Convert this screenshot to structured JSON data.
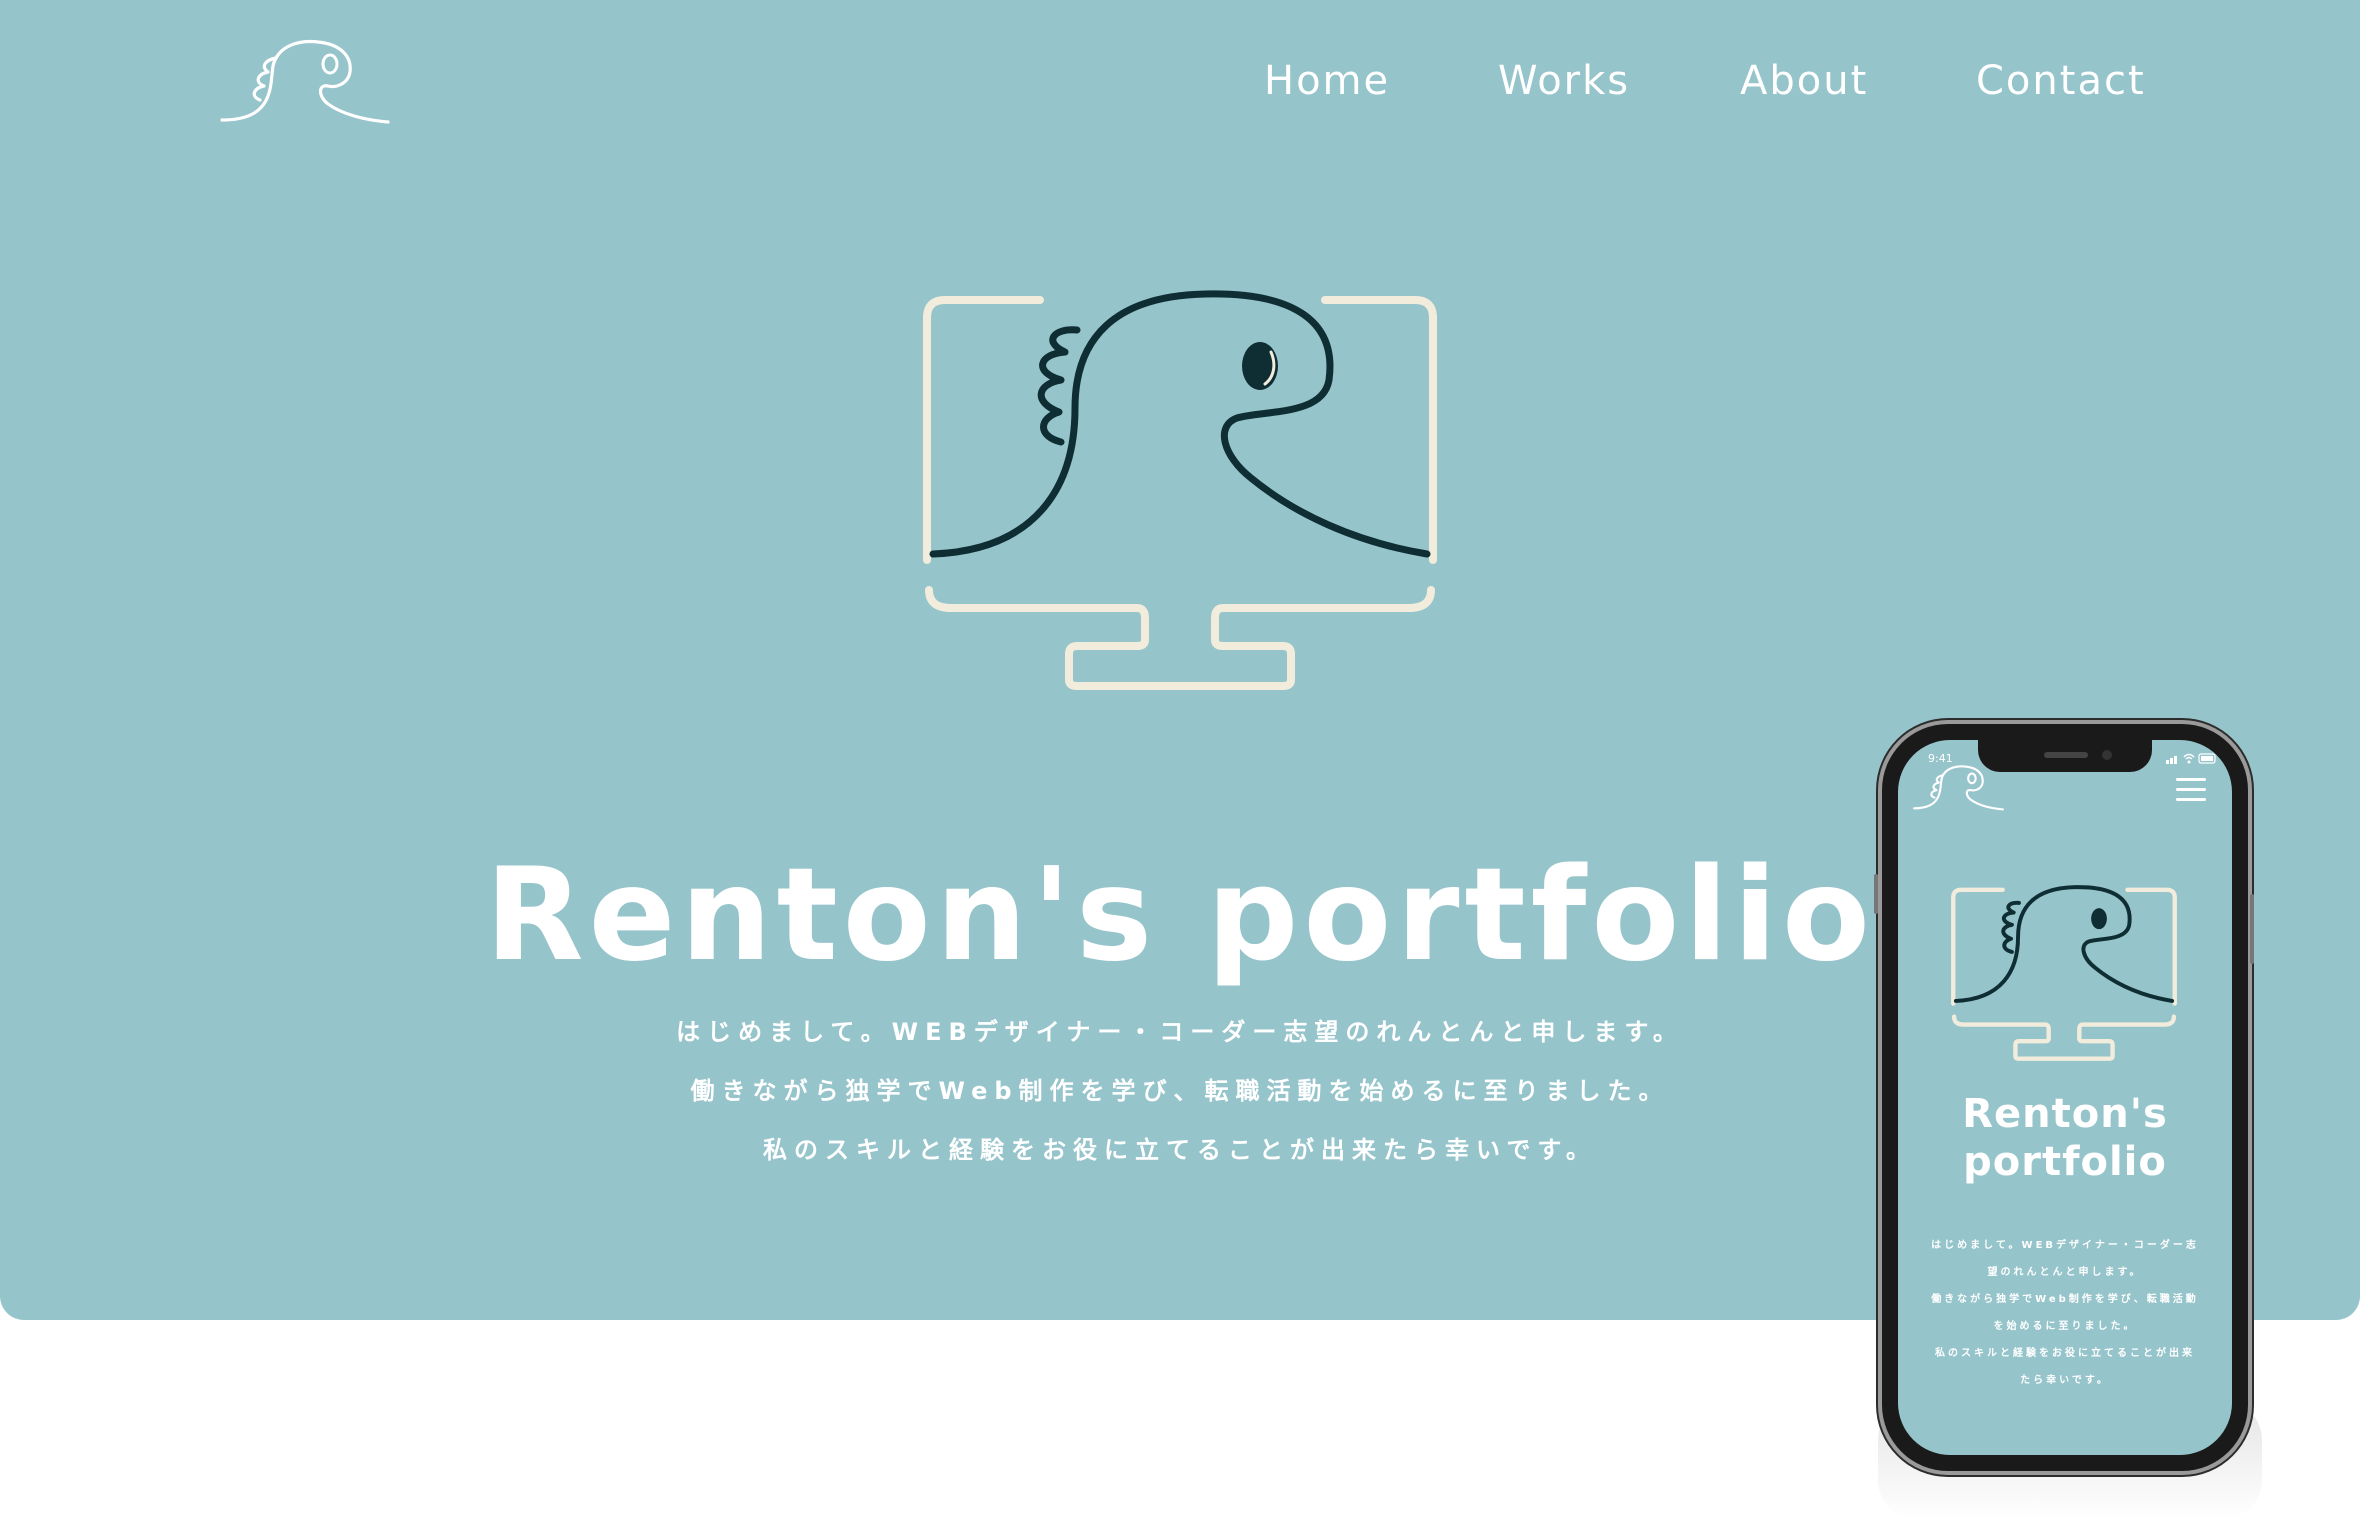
{
  "site": {
    "logo_icon": "dinosaur-r-logo",
    "colors": {
      "hero_background": "#96c4cb",
      "dino_stroke": "#0e2e34",
      "monitor_stroke": "#f2ecdc",
      "text": "#ffffff"
    }
  },
  "nav": {
    "items": [
      {
        "label": "Home"
      },
      {
        "label": "Works"
      },
      {
        "label": "About"
      },
      {
        "label": "Contact"
      }
    ]
  },
  "hero": {
    "illustration": "dinosaur-in-monitor-icon",
    "title": "Renton's portfolio",
    "intro": [
      "はじめまして。WEBデザイナー・コーダー志望のれんとんと申します。",
      "働きながら独学でWeb制作を学び、転職活動を始めるに至りました。",
      "私のスキルと経験をお役に立てることが出来たら幸いです。"
    ]
  },
  "mobile": {
    "status_time": "9:41",
    "menu_icon": "hamburger-icon",
    "title_line1": "Renton's",
    "title_line2": "portfolio",
    "intro": [
      "はじめまして。WEBデザイナー・コーダー志",
      "望のれんとんと申します。",
      "働きながら独学でWeb制作を学び、転職活動",
      "を始めるに至りました。",
      "私のスキルと経験をお役に立てることが出来",
      "たら幸いです。"
    ]
  }
}
